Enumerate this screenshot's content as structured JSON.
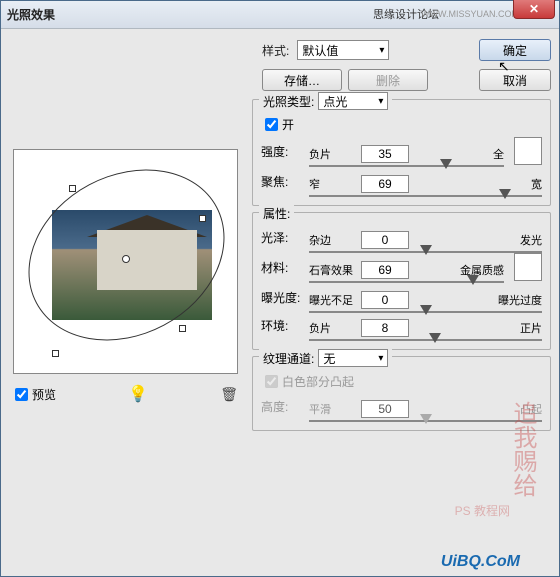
{
  "window": {
    "title": "光照效果",
    "forum": "思缘设计论坛",
    "forum_url": "WWW.MISSYUAN.COM"
  },
  "buttons": {
    "ok": "确定",
    "cancel": "取消",
    "save": "存储…",
    "delete": "删除"
  },
  "style": {
    "label": "样式:",
    "value": "默认值"
  },
  "preview": {
    "checkbox_label": "预览"
  },
  "light_type": {
    "group_label": "光照类型:",
    "value": "点光",
    "on_label": "开"
  },
  "intensity": {
    "label": "强度:",
    "left": "负片",
    "value": "35",
    "right": "全",
    "pos": 70
  },
  "focus": {
    "label": "聚焦:",
    "left": "窄",
    "value": "69",
    "right": "宽",
    "pos": 84
  },
  "properties": {
    "group_label": "属性:"
  },
  "gloss": {
    "label": "光泽:",
    "left": "杂边",
    "value": "0",
    "right": "发光",
    "pos": 50
  },
  "material": {
    "label": "材料:",
    "left": "石膏效果",
    "value": "69",
    "right": "金属质感",
    "pos": 84
  },
  "exposure": {
    "label": "曝光度:",
    "left": "曝光不足",
    "value": "0",
    "right": "曝光过度",
    "pos": 50
  },
  "ambience": {
    "label": "环境:",
    "left": "负片",
    "value": "8",
    "right": "正片",
    "pos": 54
  },
  "texture": {
    "group_label": "纹理通道:",
    "value": "无",
    "white_high_label": "白色部分凸起"
  },
  "height": {
    "label": "高度:",
    "left": "平滑",
    "value": "50",
    "right": "凸起",
    "pos": 50
  },
  "footer": {
    "url": "UiBQ.CoM"
  },
  "watermark": {
    "text1": "追我赐给",
    "text2": "PS 教程网"
  }
}
